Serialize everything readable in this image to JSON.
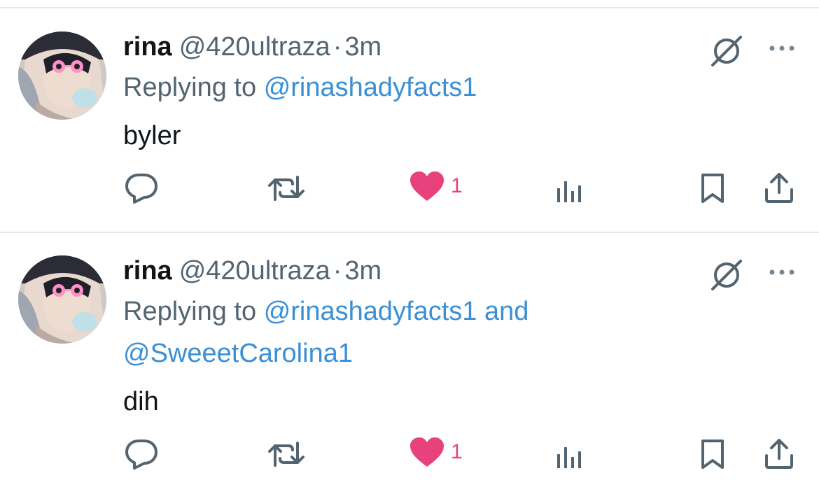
{
  "tweets": [
    {
      "display_name": "rina",
      "handle": "@420ultraza",
      "separator": "·",
      "time": "3m",
      "replying_prefix": "Replying to",
      "mentions_line1": "@rinashadyfacts1",
      "mentions_line2": "",
      "body": "byler",
      "like_count": "1",
      "liked": true
    },
    {
      "display_name": "rina",
      "handle": "@420ultraza",
      "separator": "·",
      "time": "3m",
      "replying_prefix": "Replying to",
      "mentions_line1": "@rinashadyfacts1 and",
      "mentions_line2": "@SweeetCarolina1",
      "body": "dih",
      "like_count": "1",
      "liked": true
    }
  ],
  "icons": {
    "reply": "reply-icon",
    "retweet": "retweet-icon",
    "like": "heart-icon",
    "views": "analytics-icon",
    "bookmark": "bookmark-icon",
    "share": "share-icon",
    "grok": "grok-icon",
    "more": "more-icon"
  },
  "colors": {
    "text": "#0f1419",
    "secondary": "#536471",
    "link": "#3b8fd6",
    "like": "#e8427d",
    "divider": "#e6e8ea"
  }
}
